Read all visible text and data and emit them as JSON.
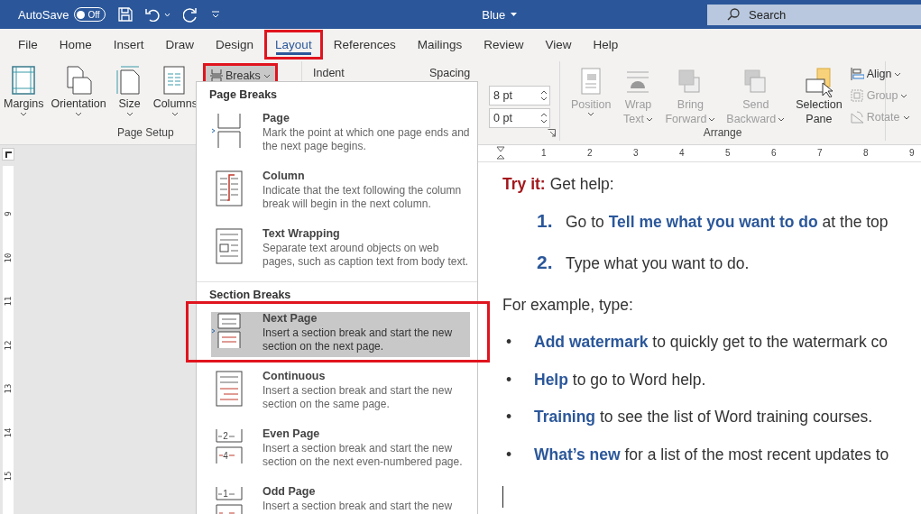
{
  "title_bar": {
    "autosave_label": "AutoSave",
    "autosave_toggle": {
      "label": "Off",
      "on": false
    },
    "document_title": "Blue",
    "search": {
      "placeholder": "Search"
    }
  },
  "tabs": [
    {
      "label": "File",
      "selected": false,
      "highlighted": false
    },
    {
      "label": "Home",
      "selected": false,
      "highlighted": false
    },
    {
      "label": "Insert",
      "selected": false,
      "highlighted": false
    },
    {
      "label": "Draw",
      "selected": false,
      "highlighted": false
    },
    {
      "label": "Design",
      "selected": false,
      "highlighted": false
    },
    {
      "label": "Layout",
      "selected": true,
      "highlighted": true
    },
    {
      "label": "References",
      "selected": false,
      "highlighted": false
    },
    {
      "label": "Mailings",
      "selected": false,
      "highlighted": false
    },
    {
      "label": "Review",
      "selected": false,
      "highlighted": false
    },
    {
      "label": "View",
      "selected": false,
      "highlighted": false
    },
    {
      "label": "Help",
      "selected": false,
      "highlighted": false
    }
  ],
  "ribbon": {
    "page_setup": {
      "group_label": "Page Setup",
      "buttons": [
        {
          "label": "Margins",
          "kind": "margins"
        },
        {
          "label": "Orientation",
          "kind": "orientation"
        },
        {
          "label": "Size",
          "kind": "size"
        },
        {
          "label": "Columns",
          "kind": "columns"
        }
      ],
      "breaks_button": {
        "label": "Breaks",
        "pressed": true,
        "highlighted": true
      }
    },
    "paragraph": {
      "indent_label": "Indent",
      "spacing_label": "Spacing",
      "spacing_fields": [
        {
          "value": "8 pt"
        },
        {
          "value": "0 pt"
        }
      ]
    },
    "arrange": {
      "group_label": "Arrange",
      "buttons": [
        {
          "lines": [
            "Position"
          ],
          "kind": "position",
          "disabled": true,
          "dropdown": true
        },
        {
          "lines": [
            "Wrap",
            "Text"
          ],
          "kind": "wrap",
          "disabled": true,
          "dropdown": true
        },
        {
          "lines": [
            "Bring",
            "Forward"
          ],
          "kind": "bring",
          "disabled": true,
          "dropdown": true
        },
        {
          "lines": [
            "Send",
            "Backward"
          ],
          "kind": "send",
          "disabled": true,
          "dropdown": true
        },
        {
          "lines": [
            "Selection",
            "Pane"
          ],
          "kind": "selection",
          "disabled": false,
          "dropdown": false
        }
      ],
      "small_buttons": [
        {
          "label": "Align",
          "kind": "align",
          "disabled": false
        },
        {
          "label": "Group",
          "kind": "group",
          "disabled": true
        },
        {
          "label": "Rotate",
          "kind": "rotate",
          "disabled": true
        }
      ]
    }
  },
  "horizontal_ruler": {
    "numbers": [
      "1",
      "2",
      "3",
      "4",
      "5",
      "6",
      "7",
      "8",
      "9"
    ]
  },
  "vertical_ruler": {
    "numbers": [
      "9",
      "10",
      "11",
      "12",
      "13",
      "14",
      "15"
    ]
  },
  "breaks_menu": {
    "sections": [
      {
        "heading": "Page Breaks",
        "items": [
          {
            "kind": "page",
            "title": "Page",
            "description": "Mark the point at which one page ends and the next page begins.",
            "selected": false,
            "highlighted": false
          },
          {
            "kind": "column",
            "title": "Column",
            "description": "Indicate that the text following the column break will begin in the next column.",
            "selected": false,
            "highlighted": false
          },
          {
            "kind": "text_wrapping",
            "title": "Text Wrapping",
            "description": "Separate text around objects on web pages, such as caption text from body text.",
            "selected": false,
            "highlighted": false
          }
        ]
      },
      {
        "heading": "Section Breaks",
        "items": [
          {
            "kind": "next_page",
            "title": "Next Page",
            "description": "Insert a section break and start the new section on the next page.",
            "selected": true,
            "highlighted": true
          },
          {
            "kind": "continuous",
            "title": "Continuous",
            "description": "Insert a section break and start the new section on the same page.",
            "selected": false,
            "highlighted": false
          },
          {
            "kind": "even_page",
            "title": "Even Page",
            "description": "Insert a section break and start the new section on the next even-numbered page.",
            "icon_numbers": [
              "2",
              "4"
            ],
            "selected": false,
            "highlighted": false
          },
          {
            "kind": "odd_page",
            "title": "Odd Page",
            "description": "Insert a section break and start the new",
            "icon_numbers": [
              "1"
            ],
            "selected": false,
            "highlighted": false
          }
        ]
      }
    ]
  },
  "document": {
    "paragraphs": [
      {
        "kind": "lead",
        "lead": "Try it:",
        "text": "Get help:"
      },
      {
        "kind": "numbered",
        "marker": "1.",
        "text": "Go to **Tell me what you want to do** at the top"
      },
      {
        "kind": "numbered",
        "marker": "2.",
        "text": "Type what you want to do."
      },
      {
        "kind": "plain",
        "text": "For example, type:"
      },
      {
        "kind": "bullet",
        "marker": "•",
        "text": "**Add watermark** to quickly get to the watermark co"
      },
      {
        "kind": "bullet",
        "marker": "•",
        "text": "**Help** to go to Word help."
      },
      {
        "kind": "bullet",
        "marker": "•",
        "text": "**Training** to see the list of Word training courses."
      },
      {
        "kind": "bullet",
        "marker": "•",
        "text": "**What’s new** for a list of the most recent updates to"
      },
      {
        "kind": "cursor"
      }
    ]
  }
}
